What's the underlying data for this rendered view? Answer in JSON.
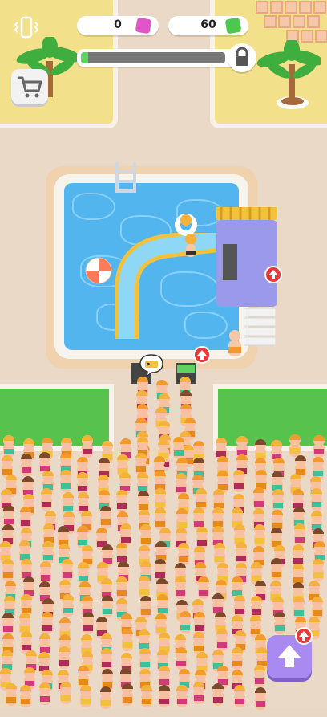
{
  "hud": {
    "pink_gems": {
      "icon": "pink-gem-icon",
      "value": "0",
      "color": "#e055c8"
    },
    "cash": {
      "icon": "green-cash-icon",
      "value": "60",
      "color": "#4fc64f"
    },
    "progress_fraction": 0.05,
    "lock_icon": "lock-icon",
    "vibration_icon": "phone-vibration-icon",
    "shop_icon": "shopping-cart-icon"
  },
  "buttons": {
    "boost_icon": "upgrade-arrow-icon",
    "boost_color": "#a98af0"
  },
  "world": {
    "ticket_bubble_icon": "ticket-icon",
    "upgrade_marker_icon": "up-arrow-icon",
    "marker_color": "#e53a3a",
    "water_color": "#53b5ee",
    "grass_color": "#58c34c"
  }
}
